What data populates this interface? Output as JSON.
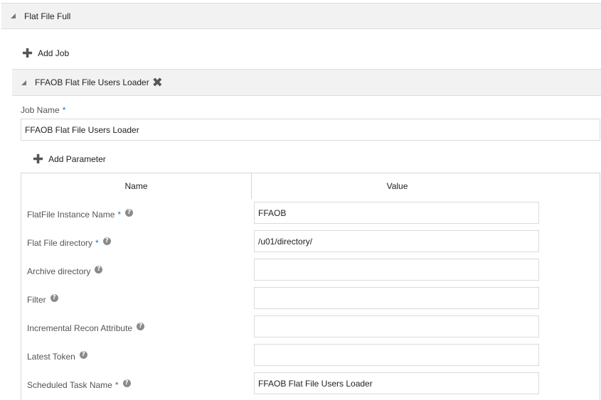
{
  "section": {
    "title": "Flat File Full"
  },
  "add_job": {
    "label": "Add Job"
  },
  "job": {
    "header_title": "FFAOB Flat File Users Loader",
    "name_label": "Job Name",
    "required_mark": "*",
    "name_value": "FFAOB Flat File Users Loader"
  },
  "add_parameter": {
    "label": "Add Parameter"
  },
  "table": {
    "col_name": "Name",
    "col_value": "Value",
    "rows": [
      {
        "label": "FlatFile Instance Name",
        "required": "*",
        "value": "FFAOB"
      },
      {
        "label": "Flat File directory",
        "required": "*",
        "value": "/u01/directory/"
      },
      {
        "label": "Archive directory",
        "required": "",
        "value": ""
      },
      {
        "label": "Filter",
        "required": "",
        "value": ""
      },
      {
        "label": "Incremental Recon Attribute",
        "required": "",
        "value": ""
      },
      {
        "label": "Latest Token",
        "required": "",
        "value": ""
      },
      {
        "label": "Scheduled Task Name",
        "required": "*",
        "value": "FFAOB Flat File Users Loader"
      }
    ]
  },
  "icons": {
    "collapse": "triangle-collapse-icon",
    "add": "plus-icon",
    "remove": "close-icon",
    "help": "help-icon"
  },
  "colors": {
    "required": "#2a6fb5",
    "header_bg": "#f2f2f2",
    "icon": "#555555"
  }
}
